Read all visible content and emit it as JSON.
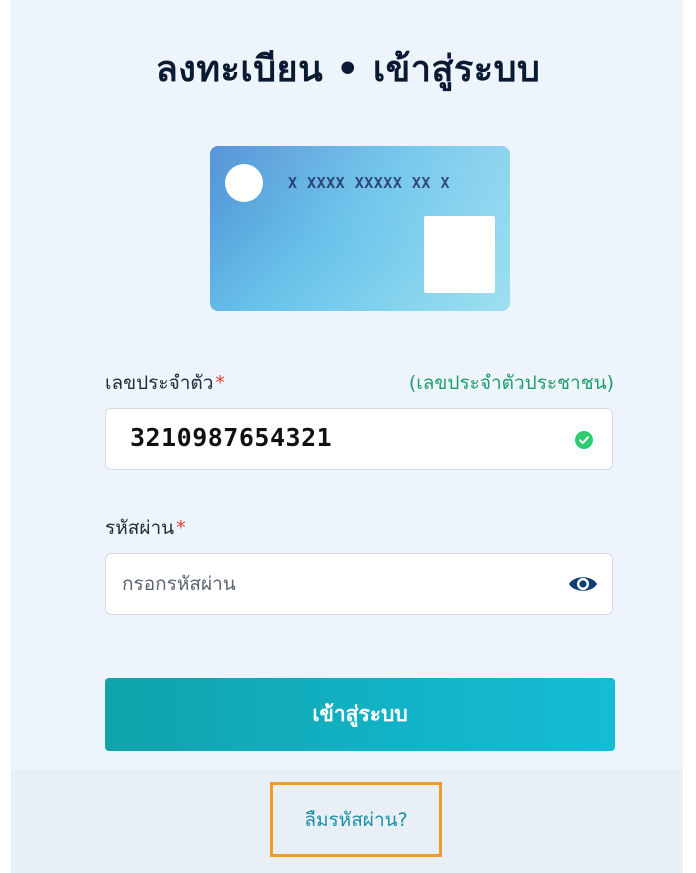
{
  "header": {
    "title": "ลงทะเบียน • เข้าสู่ระบบ"
  },
  "id_card": {
    "number": "X XXXX XXXXX XX X"
  },
  "id_field": {
    "label": "เลขประจำตัว",
    "required_mark": "*",
    "hint": "(เลขประจำตัวประชาชน)",
    "value": "3210987654321",
    "status_icon": "check-circle-icon"
  },
  "password_field": {
    "label": "รหัสผ่าน",
    "required_mark": "*",
    "placeholder": "กรอกรหัสผ่าน",
    "toggle_icon": "eye-icon"
  },
  "actions": {
    "login_label": "เข้าสู่ระบบ",
    "forgot_label": "ลืมรหัสผ่าน?"
  },
  "colors": {
    "primary": "#12b3c8",
    "valid": "#2ecc71",
    "required": "#e53935",
    "hint": "#1e9e6b",
    "highlight": "#f39a2b"
  }
}
